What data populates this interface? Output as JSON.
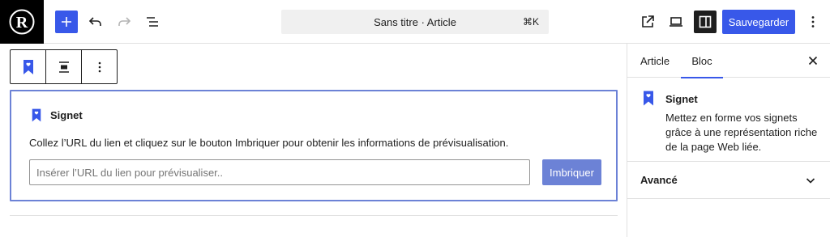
{
  "header": {
    "document_title": "Sans titre · Article",
    "shortcut": "⌘K",
    "save_label": "Sauvegarder",
    "logo_letter": "R"
  },
  "block": {
    "title": "Signet",
    "description": "Collez l’URL du lien et cliquez sur le bouton Imbriquer pour obtenir les informations de prévisualisation.",
    "input_placeholder": "Insérer l’URL du lien pour prévisualiser..",
    "input_value": "",
    "embed_button": "Imbriquer"
  },
  "sidebar": {
    "tabs": [
      {
        "label": "Article",
        "active": false
      },
      {
        "label": "Bloc",
        "active": true
      }
    ],
    "block_card": {
      "name": "Signet",
      "description": "Mettez en forme vos signets grâce à une représentation riche de la page Web liée."
    },
    "advanced_label": "Avancé"
  },
  "colors": {
    "accent": "#3858e9",
    "block_border": "#6c82d6",
    "dark": "#1e1e1e"
  }
}
